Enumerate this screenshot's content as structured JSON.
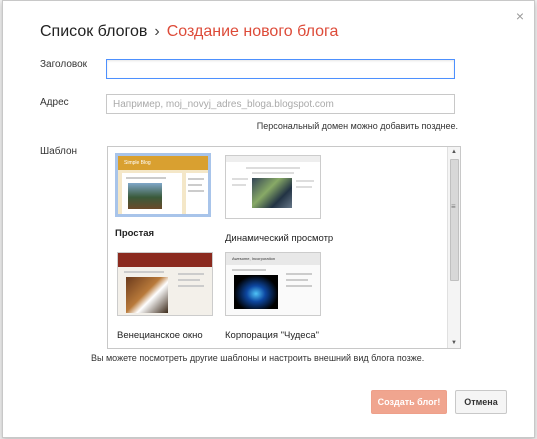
{
  "dialog": {
    "breadcrumb_root": "Список блогов",
    "breadcrumb_sep": "›",
    "title": "Создание нового блога",
    "close_label": "×"
  },
  "form": {
    "title_label": "Заголовок",
    "title_value": "",
    "address_label": "Адрес",
    "address_placeholder": "Например, moj_novyj_adres_bloga.blogspot.com",
    "address_hint": "Персональный домен можно добавить позднее.",
    "template_label": "Шаблон"
  },
  "templates": [
    {
      "name": "Простая",
      "selected": true,
      "thumb_title": "Simple Blog"
    },
    {
      "name": "Динамический просмотр",
      "selected": false
    },
    {
      "name": "Венецианское окно",
      "selected": false
    },
    {
      "name": "Корпорация \"Чудеса\"",
      "selected": false,
      "thumb_title": "Awesome, Incorporation"
    }
  ],
  "templates_hint": "Вы можете посмотреть другие шаблоны и настроить внешний вид блога позже.",
  "buttons": {
    "create": "Создать блог!",
    "cancel": "Отмена"
  },
  "colors": {
    "accent": "#dd4b39",
    "focus_border": "#4d90fe",
    "create_button": "#f0a58f",
    "selected_template_border": "#a8c4ea"
  }
}
